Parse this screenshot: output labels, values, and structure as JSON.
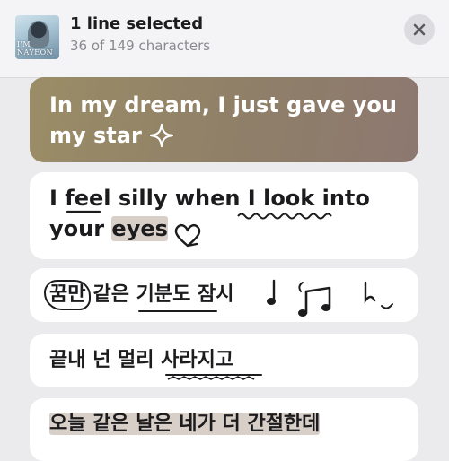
{
  "header": {
    "title": "1 line selected",
    "subtitle": "36 of 149 characters",
    "artwork_text": "I'M NAYEON",
    "close_icon": "close-icon"
  },
  "lines": [
    {
      "text_a": "In my dream, I just gave you",
      "text_b": "my star",
      "selected": true
    },
    {
      "text_a": "I feel silly when I look into",
      "text_b": "your",
      "highlight": "eyes",
      "selected": false
    },
    {
      "boxed": "꿈만",
      "text": "같은 기분도 잠시",
      "selected": false
    },
    {
      "text": "끝내 넌 멀리 사라지고",
      "selected": false
    },
    {
      "text": "오늘 같은 날은 네가 더 간절한데",
      "selected": false
    }
  ],
  "colors": {
    "selected_gradient_start": "#9a8d66",
    "selected_gradient_end": "#8d7870",
    "card_bg": "#ffffff",
    "page_bg": "#ebebed",
    "highlight": "#d8cfc8"
  }
}
